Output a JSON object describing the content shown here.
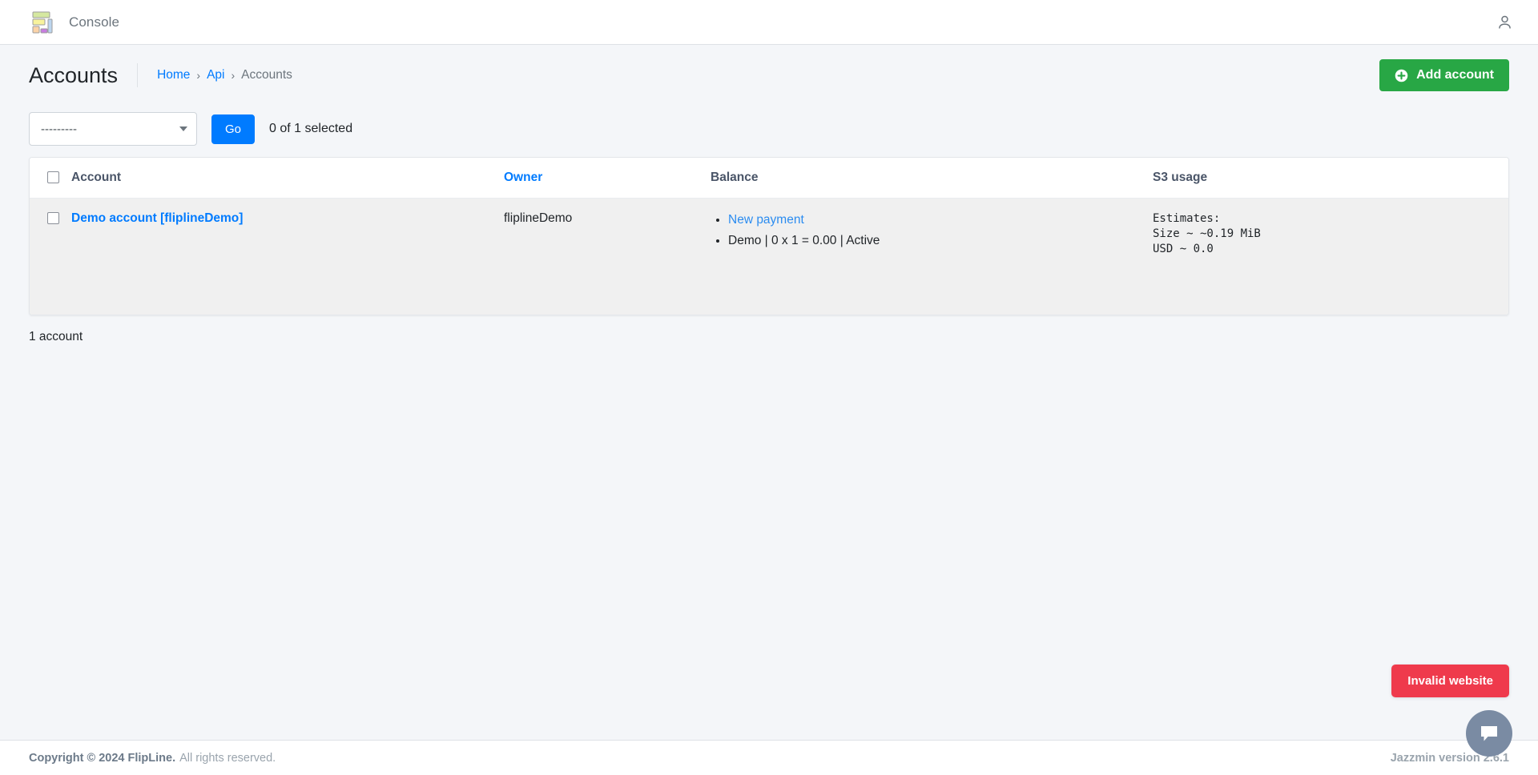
{
  "navbar": {
    "brand_title": "Console",
    "logo_icon": "dashboard-blocks-logo",
    "user_icon": "user-icon"
  },
  "header": {
    "page_title": "Accounts",
    "breadcrumb": [
      {
        "label": "Home",
        "is_link": true
      },
      {
        "label": "Api",
        "is_link": true
      },
      {
        "label": "Accounts",
        "is_link": false
      }
    ],
    "separator": "›",
    "add_button": {
      "label": "Add account",
      "icon": "plus-circle-icon",
      "color": "#28a745"
    }
  },
  "toolbar": {
    "action_select_value": "---------",
    "action_select_options": [
      "---------"
    ],
    "go_label": "Go",
    "selected_text": "0 of 1 selected",
    "go_color": "#007bff"
  },
  "table": {
    "columns": [
      {
        "key": "select_all",
        "label": "",
        "icon": "checkbox-icon",
        "is_link": false
      },
      {
        "key": "account",
        "label": "Account",
        "is_link": false
      },
      {
        "key": "owner",
        "label": "Owner",
        "is_link": true
      },
      {
        "key": "balance",
        "label": "Balance",
        "is_link": false
      },
      {
        "key": "s3_usage",
        "label": "S3 usage",
        "is_link": false
      }
    ],
    "rows": [
      {
        "account": "Demo account [fliplineDemo]",
        "owner": "fliplineDemo",
        "balance_items": [
          {
            "text": "New payment",
            "is_link": true
          },
          {
            "text": "Demo | 0 x 1 = 0.00 | Active",
            "is_link": false
          }
        ],
        "s3_usage": "Estimates:\nSize ~ ~0.19 MiB\nUSD ~ 0.0"
      }
    ],
    "result_count": "1 account"
  },
  "floating": {
    "invalid_badge": "Invalid website",
    "invalid_badge_color": "#ef3a4c",
    "chat_icon": "chat-bubble-icon"
  },
  "footer": {
    "copyright_strong": "Copyright © 2024 FlipLine.",
    "rights": "All rights reserved.",
    "jazzmin_version": "Jazzmin version 2.6.1"
  }
}
